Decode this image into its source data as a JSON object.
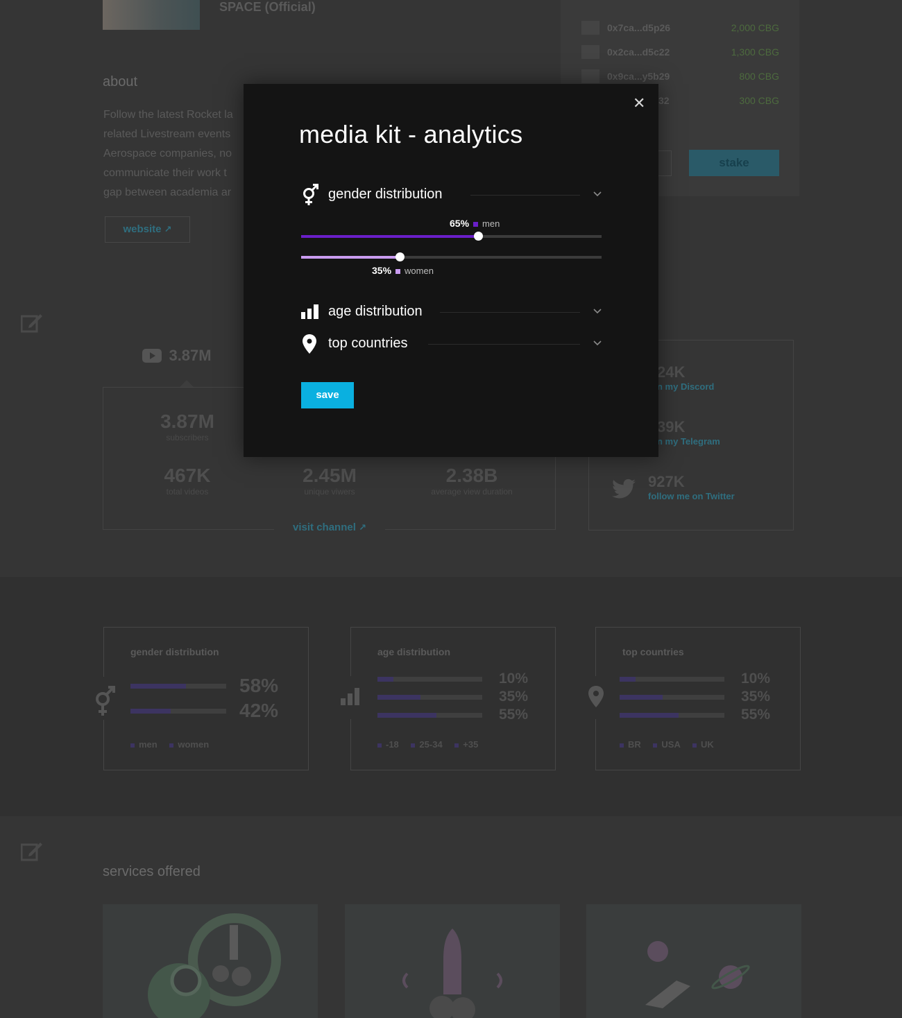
{
  "profile": {
    "name": "SPACE (Official)"
  },
  "about": {
    "heading": "about",
    "text_lines": [
      "Follow the latest Rocket la",
      "related Livestream events",
      "Aerospace companies, no",
      "communicate their work t",
      "gap between academia ar"
    ],
    "website_label": "website"
  },
  "stakers": {
    "items": [
      {
        "addr": "0x7ca...d5p26",
        "amount": "2,000 CBG"
      },
      {
        "addr": "0x2ca...d5c22",
        "amount": "1,300 CBG"
      },
      {
        "addr": "0x9ca...y5b29",
        "amount": "800 CBG"
      },
      {
        "addr": "32",
        "amount": "300 CBG"
      }
    ],
    "stake_label": "stake"
  },
  "channel": {
    "tab_value": "3.87M",
    "stats": [
      {
        "value": "3.87M",
        "label": "subscribers"
      },
      {
        "value": "467K",
        "label": "total videos"
      },
      {
        "value": "2.45M",
        "label": "unique viwers"
      },
      {
        "value": "2.38B",
        "label": "average view duration"
      }
    ],
    "visit_label": "visit channel"
  },
  "social": [
    {
      "value": "24K",
      "label": "n my Discord"
    },
    {
      "value": "39K",
      "label": "n my Telegram"
    },
    {
      "value": "927K",
      "label": "follow me on Twitter"
    }
  ],
  "analytics_cards": {
    "gender": {
      "title": "gender distribution",
      "values": [
        "58%",
        "42%"
      ],
      "fractions": [
        0.58,
        0.42
      ],
      "legend": [
        "men",
        "women"
      ]
    },
    "age": {
      "title": "age distribution",
      "values": [
        "10%",
        "35%",
        "55%"
      ],
      "fractions": [
        0.15,
        0.41,
        0.56
      ],
      "legend": [
        "-18",
        "25-34",
        "+35"
      ]
    },
    "countries": {
      "title": "top countries",
      "values": [
        "10%",
        "35%",
        "55%"
      ],
      "fractions": [
        0.15,
        0.41,
        0.56
      ],
      "legend": [
        "BR",
        "USA",
        "UK"
      ]
    }
  },
  "services": {
    "heading": "services offered"
  },
  "modal": {
    "title": "media kit - analytics",
    "close_glyph": "✕",
    "sections": {
      "gender": "gender distribution",
      "age": "age distribution",
      "countries": "top countries"
    },
    "sliders": [
      {
        "percent": "65%",
        "name": "men",
        "fraction": 0.59,
        "color": "#6a1fc9"
      },
      {
        "percent": "35%",
        "name": "women",
        "fraction": 0.33,
        "color": "#c99bf0"
      }
    ],
    "save_label": "save"
  },
  "colors": {
    "accent": "#0ab0e0",
    "men": "#6a1fc9",
    "women": "#c99bf0"
  }
}
